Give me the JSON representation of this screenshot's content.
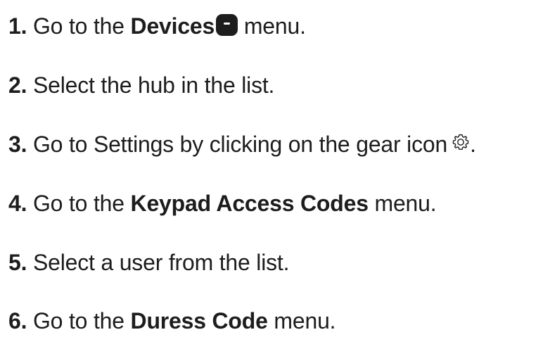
{
  "steps": [
    {
      "number": "1.",
      "text_before": " Go to the ",
      "bold": "Devices",
      "text_after": " menu.",
      "icon": "devices-icon"
    },
    {
      "number": "2.",
      "text": " Select the hub in the list."
    },
    {
      "number": "3.",
      "text": " Go to Settings by clicking on the gear icon",
      "icon": "gear-icon",
      "text_after": "."
    },
    {
      "number": "4.",
      "text_before": " Go to the ",
      "bold": "Keypad Access Codes",
      "text_after": " menu."
    },
    {
      "number": "5.",
      "text": " Select a user from the list."
    },
    {
      "number": "6.",
      "text_before": " Go to the ",
      "bold": "Duress Code",
      "text_after": " menu."
    }
  ]
}
